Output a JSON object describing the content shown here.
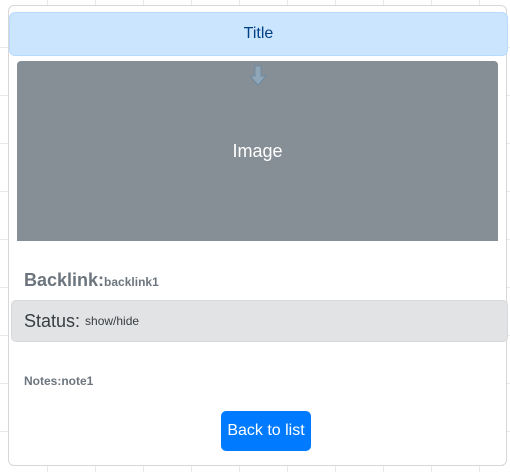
{
  "card": {
    "title": "Title",
    "image": {
      "label": "Image",
      "icon": "arrow-down-icon"
    },
    "backlink": {
      "label": "Backlink:",
      "value": "backlink1"
    },
    "status": {
      "label": "Status:",
      "value": "show/hide"
    },
    "notes": {
      "label": "Notes:",
      "value": "note1"
    },
    "back_button_label": "Back to list"
  },
  "colors": {
    "title_bg": "#cce5ff",
    "title_text": "#004085",
    "image_bg": "#868e96",
    "status_bg": "#e2e3e5",
    "button_bg": "#007bff"
  }
}
